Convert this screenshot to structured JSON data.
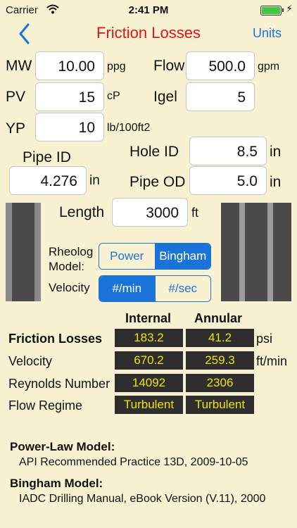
{
  "status": {
    "carrier": "Carrier",
    "time": "2:41 PM"
  },
  "nav": {
    "title": "Friction Losses",
    "units": "Units"
  },
  "inputs": {
    "mw": {
      "label": "MW",
      "value": "10.00",
      "unit": "ppg"
    },
    "flow": {
      "label": "Flow",
      "value": "500.0",
      "unit": "gpm"
    },
    "pv": {
      "label": "PV",
      "value": "15",
      "unit": "cP"
    },
    "igel": {
      "label": "Igel",
      "value": "5"
    },
    "yp": {
      "label": "YP",
      "value": "10",
      "unit": "lb/100ft2"
    },
    "pipe_id": {
      "label": "Pipe ID",
      "value": "4.276",
      "unit": "in"
    },
    "hole_id": {
      "label": "Hole ID",
      "value": "8.5",
      "unit": "in"
    },
    "pipe_od": {
      "label": "Pipe OD",
      "value": "5.0",
      "unit": "in"
    },
    "length": {
      "label": "Length",
      "value": "3000",
      "unit": "ft"
    }
  },
  "rheology": {
    "label_line1": "Rheolog",
    "label_line2": "Model:",
    "options": [
      "Power",
      "Bingham"
    ],
    "selected": "Bingham"
  },
  "velocity": {
    "label": "Velocity",
    "options": [
      "#/min",
      "#/sec"
    ],
    "selected": "#/min"
  },
  "results": {
    "col_internal": "Internal",
    "col_annular": "Annular",
    "rows": [
      {
        "label": "Friction Losses",
        "internal": "183.2",
        "annular": "41.2",
        "unit": "psi"
      },
      {
        "label": "Velocity",
        "internal": "670.2",
        "annular": "259.3",
        "unit": "ft/min"
      },
      {
        "label": "Reynolds Number",
        "internal": "14092",
        "annular": "2306",
        "unit": ""
      },
      {
        "label": "Flow Regime",
        "internal": "Turbulent",
        "annular": "Turbulent",
        "unit": ""
      }
    ]
  },
  "references": {
    "power_title": "Power-Law Model:",
    "power_text": "API Recommended Practice 13D, 2009-10-05",
    "bingham_title": "Bingham Model:",
    "bingham_text": "IADC Drilling Manual, eBook Version (V.11), 2000"
  },
  "colors": {
    "accent": "#1a73d9",
    "title": "#e0131b",
    "cell_text": "#f2e010",
    "background": "#f8f2d2"
  }
}
